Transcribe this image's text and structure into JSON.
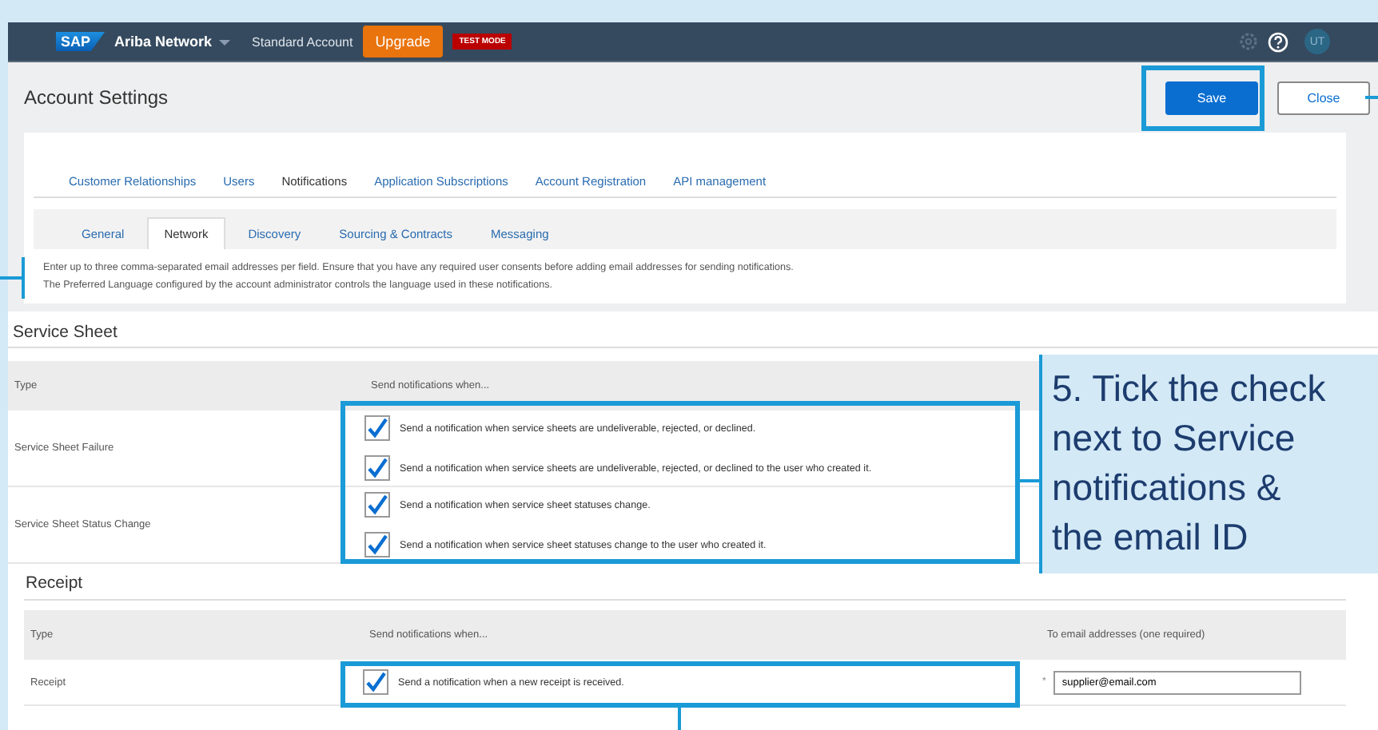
{
  "header": {
    "logo": "SAP",
    "product": "Ariba Network",
    "account_type": "Standard Account",
    "upgrade": "Upgrade",
    "mode_badge": "TEST MODE",
    "avatar": "UT"
  },
  "page": {
    "title": "Account Settings",
    "buttons": [
      {
        "label": "Save",
        "kind": "primary"
      },
      {
        "label": "Close",
        "kind": "secondary"
      }
    ]
  },
  "tabs": [
    {
      "label": "Customer Relationships",
      "selected": false
    },
    {
      "label": "Users",
      "selected": false
    },
    {
      "label": "Notifications",
      "selected": true
    },
    {
      "label": "Application Subscriptions",
      "selected": false
    },
    {
      "label": "Account Registration",
      "selected": false
    },
    {
      "label": "API management",
      "selected": false
    }
  ],
  "subtabs": [
    {
      "label": "General",
      "selected": false
    },
    {
      "label": "Network",
      "selected": true
    },
    {
      "label": "Discovery",
      "selected": false
    },
    {
      "label": "Sourcing & Contracts",
      "selected": false
    },
    {
      "label": "Messaging",
      "selected": false
    }
  ],
  "info": [
    "Enter up to three comma-separated email addresses per field. Ensure that you have any required user consents before adding email addresses for sending notifications.",
    "The Preferred Language configured by the account administrator controls the language used in these notifications."
  ],
  "sections": [
    {
      "title": "Service Sheet",
      "columns": [
        "Type",
        "Send notifications when..."
      ],
      "rows": [
        {
          "type": "Service Sheet Failure",
          "options": [
            {
              "label": "Send a notification when service sheets are undeliverable, rejected, or declined.",
              "checked": true
            },
            {
              "label": "Send a notification when service sheets are undeliverable, rejected, or declined to the user who created it.",
              "checked": true
            }
          ]
        },
        {
          "type": "Service Sheet Status Change",
          "options": [
            {
              "label": "Send a notification when service sheet statuses change.",
              "checked": true
            },
            {
              "label": "Send a notification when service sheet statuses change to the user who created it.",
              "checked": true
            }
          ]
        }
      ]
    },
    {
      "title": "Receipt",
      "columns": [
        "Type",
        "Send notifications when...",
        "To email addresses (one required)"
      ],
      "rows": [
        {
          "type": "Receipt",
          "options": [
            {
              "label": "Send a notification when a new receipt is received.",
              "checked": true
            }
          ],
          "required_mark": "*",
          "email": "supplier@email.com"
        }
      ]
    }
  ],
  "callout": {
    "lines": [
      "5. Tick the check",
      "next to Service",
      "notifications &",
      "the email ID"
    ]
  }
}
